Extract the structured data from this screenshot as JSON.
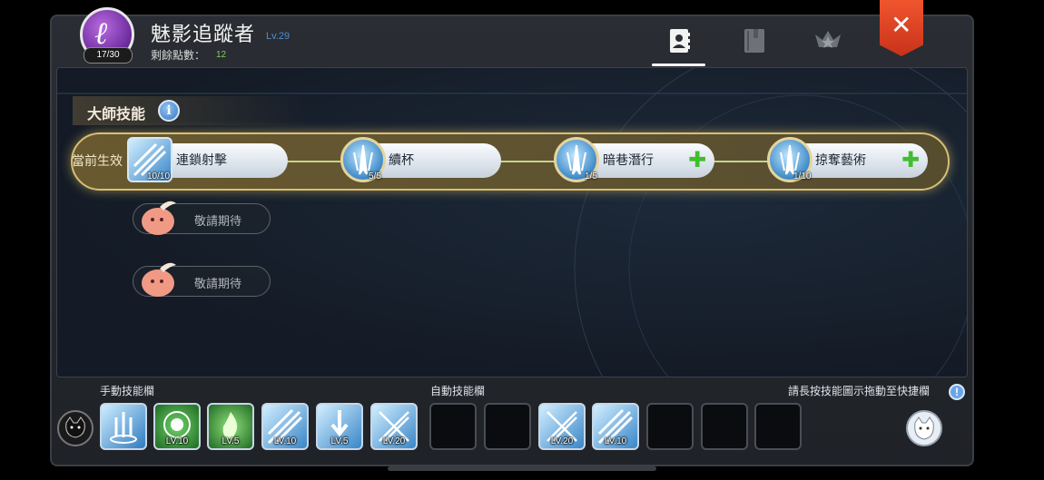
{
  "header": {
    "avatar_count": "17/30",
    "character_name": "魅影追蹤者",
    "character_level": "Lv.29",
    "skill_points_label": "剩餘點數：",
    "skill_points_value": "12",
    "tabs": [
      {
        "name": "skills-tab",
        "icon": "contact-book-icon",
        "active": true
      },
      {
        "name": "book-tab",
        "icon": "book-icon",
        "active": false
      },
      {
        "name": "rank-tab",
        "icon": "star-emblem-icon",
        "active": false
      }
    ],
    "close_icon": "close-icon"
  },
  "master_skills": {
    "title": "大師技能",
    "active_row_label": "當前生效",
    "active_skills": [
      {
        "name": "連鎖射擊",
        "level": "10/10",
        "icon": "chain-shot-icon",
        "can_upgrade": false
      },
      {
        "name": "續杯",
        "level": "5/5",
        "icon": "arrow-burst-icon",
        "can_upgrade": false
      },
      {
        "name": "暗巷潛行",
        "level": "1/5",
        "icon": "arrow-burst-icon",
        "can_upgrade": true
      },
      {
        "name": "掠奪藝術",
        "level": "1/10",
        "icon": "arrow-burst-icon",
        "can_upgrade": true
      }
    ],
    "coming_soon": [
      "敬請期待",
      "敬請期待"
    ]
  },
  "bottom_bar": {
    "manual_label": "手動技能欄",
    "auto_label": "自動技能欄",
    "hint": "請長按技能圖示拖動至快捷欄",
    "manual_slots": [
      {
        "icon": "arrow-rain-icon",
        "level": ""
      },
      {
        "icon": "skull-target-icon",
        "level": "LV.10"
      },
      {
        "icon": "green-flame-icon",
        "level": "LV.5"
      },
      {
        "icon": "chain-shot-icon",
        "level": "LV.10"
      },
      {
        "icon": "arrow-down-icon",
        "level": "LV.5"
      },
      {
        "icon": "crossed-arrows-icon",
        "level": "LV.20"
      }
    ],
    "auto_slots": [
      {
        "icon": "",
        "level": ""
      },
      {
        "icon": "",
        "level": ""
      },
      {
        "icon": "crossed-arrows-icon",
        "level": "LV.20"
      },
      {
        "icon": "chain-shot-icon",
        "level": "LV.10"
      },
      {
        "icon": "",
        "level": ""
      },
      {
        "icon": "",
        "level": ""
      },
      {
        "icon": "",
        "level": ""
      }
    ]
  },
  "colors": {
    "accent_gold": "#d9bf72",
    "close_red": "#e0431f",
    "level_blue": "#4a8fd6",
    "points_green": "#7bd45a",
    "plus_green": "#3fbf2e"
  }
}
